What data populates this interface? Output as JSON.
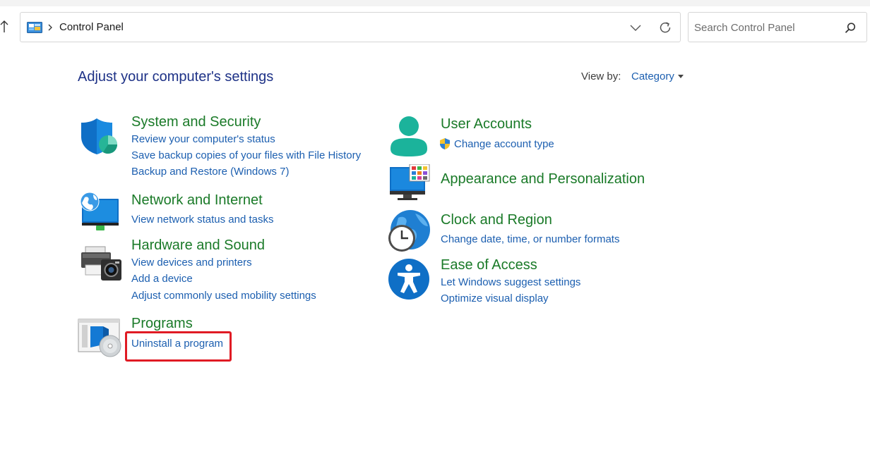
{
  "address_bar": {
    "breadcrumb": "Control Panel"
  },
  "search": {
    "placeholder": "Search Control Panel"
  },
  "header": {
    "title": "Adjust your computer's settings",
    "view_by_label": "View by:",
    "view_by_value": "Category"
  },
  "colors": {
    "category_title": "#1a7a28",
    "link": "#1c5fb0",
    "page_title": "#1e3287",
    "highlight": "#e01b24"
  },
  "categories": {
    "system_security": {
      "icon": "shield-icon",
      "title": "System and Security",
      "links": [
        "Review your computer's status",
        "Save backup copies of your files with File History",
        "Backup and Restore (Windows 7)"
      ]
    },
    "network_internet": {
      "icon": "network-globe-icon",
      "title": "Network and Internet",
      "links": [
        "View network status and tasks"
      ]
    },
    "hardware_sound": {
      "icon": "printer-camera-icon",
      "title": "Hardware and Sound",
      "links": [
        "View devices and printers",
        "Add a device",
        "Adjust commonly used mobility settings"
      ]
    },
    "programs": {
      "icon": "programs-disc-icon",
      "title": "Programs",
      "links": [
        "Uninstall a program"
      ]
    },
    "user_accounts": {
      "icon": "user-icon",
      "title": "User Accounts",
      "links": [
        "Change account type"
      ]
    },
    "appearance": {
      "icon": "monitor-palette-icon",
      "title": "Appearance and Personalization",
      "links": []
    },
    "clock_region": {
      "icon": "clock-globe-icon",
      "title": "Clock and Region",
      "links": [
        "Change date, time, or number formats"
      ]
    },
    "ease_access": {
      "icon": "accessibility-icon",
      "title": "Ease of Access",
      "links": [
        "Let Windows suggest settings",
        "Optimize visual display"
      ]
    }
  }
}
